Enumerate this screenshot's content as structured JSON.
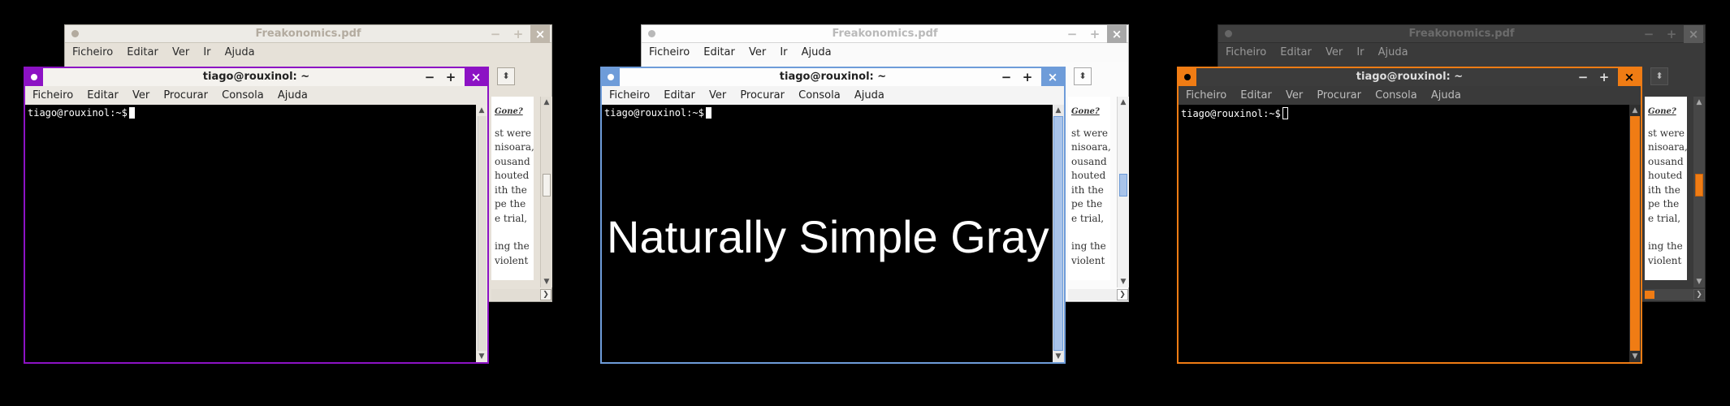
{
  "themes": [
    {
      "id": "purple",
      "accent": "#8c12c4",
      "pdf_title": "Freakonomics.pdf",
      "terminal_title": "tiago@rouxinol: ~",
      "prompt": "tiago@rouxinol:~$",
      "caption": ""
    },
    {
      "id": "gray",
      "accent": "#6e9cd9",
      "pdf_title": "Freakonomics.pdf",
      "terminal_title": "tiago@rouxinol: ~",
      "prompt": "tiago@rouxinol:~$",
      "caption": "Naturally Simple Gray"
    },
    {
      "id": "dark-orange",
      "accent": "#f07c14",
      "pdf_title": "Freakonomics.pdf",
      "terminal_title": "tiago@rouxinol: ~",
      "prompt": "tiago@rouxinol:~$",
      "caption": ""
    }
  ],
  "pdf_menu": [
    "Ficheiro",
    "Editar",
    "Ver",
    "Ir",
    "Ajuda"
  ],
  "terminal_menu": [
    "Ficheiro",
    "Editar",
    "Ver",
    "Procurar",
    "Consola",
    "Ajuda"
  ],
  "pdf_heading": "Gone?",
  "pdf_lines": [
    "st were",
    "nisoara,",
    "ousand",
    "houted",
    "ith the",
    "pe the",
    "e trial,",
    "",
    "ing the",
    "violent"
  ],
  "icons": {
    "window_menu": "circle-dot-icon",
    "minimize": "minimize-icon",
    "maximize": "maximize-icon",
    "close": "close-icon",
    "scroll_up": "triangle-up-icon",
    "scroll_down": "triangle-down-icon",
    "scroll_right": "chevron-right-icon",
    "spinner": "updown-arrows-icon"
  }
}
